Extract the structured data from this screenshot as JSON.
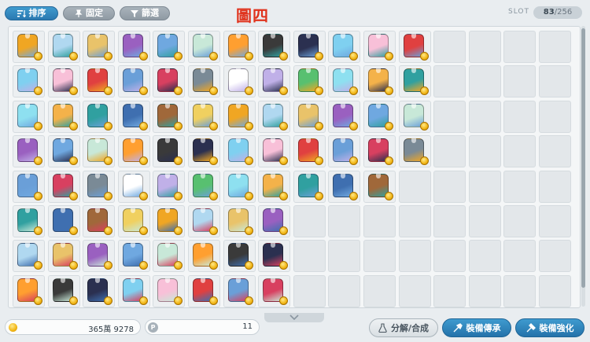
{
  "toolbar": {
    "sort_label": "排序",
    "pin_label": "固定",
    "filter_label": "篩選"
  },
  "overlay_title": "圖四",
  "slot": {
    "label": "SLOT",
    "used": "83",
    "total": "/256"
  },
  "colors": {
    "accent": "#2a78b0",
    "overlay_red": "#e0331d",
    "coin": "#f1b514"
  },
  "inventory": {
    "filled_per_row": [
      12,
      12,
      12,
      12,
      11,
      8,
      8,
      8
    ],
    "palette": [
      "#f0a623",
      "#3a3a3a",
      "#7a8a96",
      "#3f6fb0",
      "#6fa8e0",
      "#e04040",
      "#8ee0f0",
      "#b0d8f0",
      "#2b3050",
      "#ffffff",
      "#a0683a",
      "#c8e8d8",
      "#6a9fd8",
      "#f4b24a",
      "#e9c36a",
      "#7fd0f0",
      "#c0b0e8",
      "#f0d060",
      "#ff9f30",
      "#d84060",
      "#30a0a0",
      "#9a60c0",
      "#f8c0d8",
      "#58c070"
    ],
    "icons": [
      "bag-icon",
      "shirt-icon",
      "armor-icon",
      "coat-icon",
      "robe-icon",
      "dress-icon",
      "pants-icon",
      "hat-icon"
    ]
  },
  "money": {
    "icon": "meso-coin-icon",
    "value": "365萬 9278"
  },
  "points": {
    "icon_letter": "P",
    "value": "11"
  },
  "actions": {
    "disassemble_label": "分解/合成",
    "transfer_label": "裝備傳承",
    "enhance_label": "裝備強化"
  }
}
